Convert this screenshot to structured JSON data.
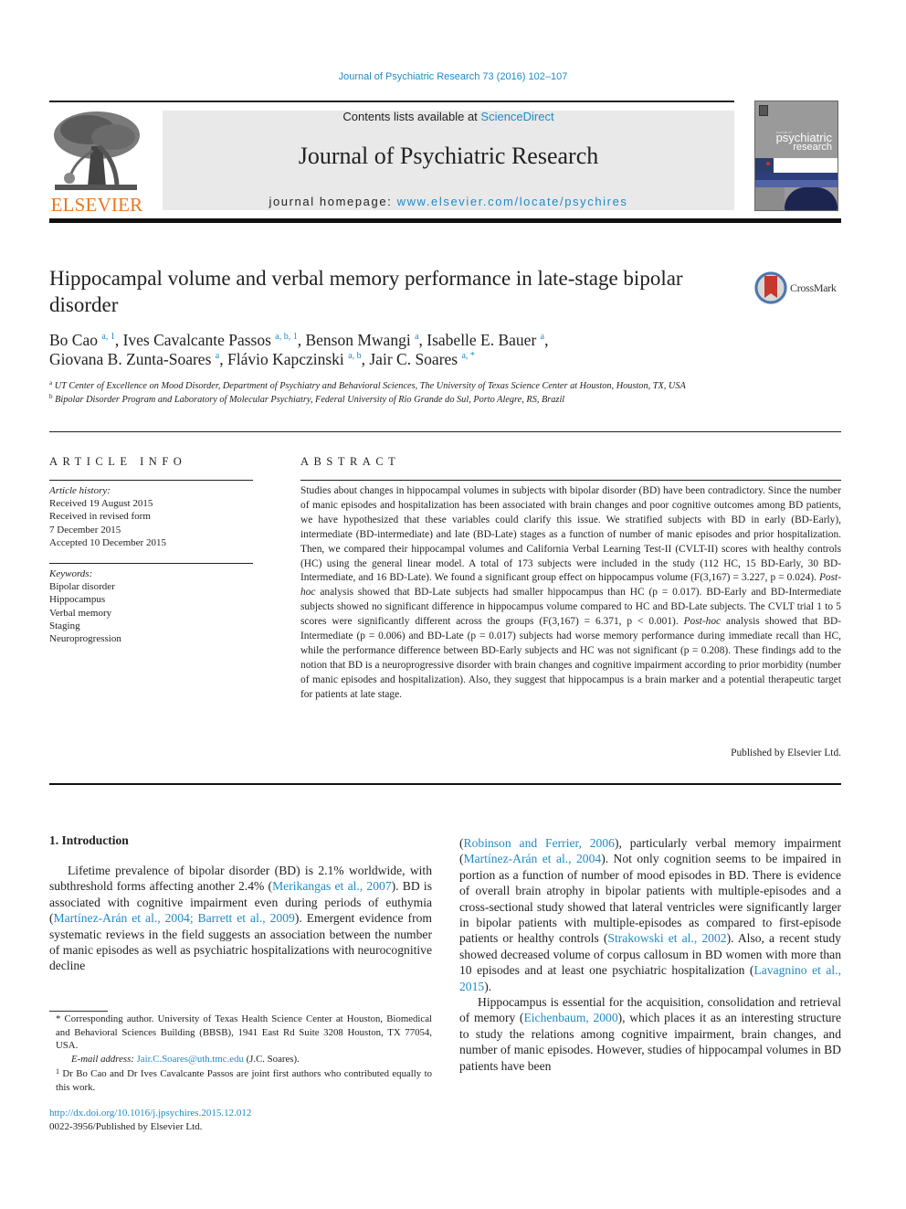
{
  "header": {
    "citation": "Journal of Psychiatric Research 73 (2016) 102–107",
    "publisher_logo_text": "ELSEVIER",
    "contents_prefix": "Contents lists available at ",
    "contents_link": "ScienceDirect",
    "journal_title": "Journal of Psychiatric Research",
    "homepage_prefix": "journal homepage: ",
    "homepage_link": "www.elsevier.com/locate/psychires",
    "cover": {
      "small_text": "Journal of",
      "title_line1": "psychiatric",
      "title_line2": "research"
    },
    "colors": {
      "link": "#1f8bc7",
      "elsevier_orange": "#e87722",
      "banner_bg": "#e9e9e9"
    }
  },
  "article": {
    "title": "Hippocampal volume and verbal memory performance in late-stage bipolar disorder",
    "crossmark_label": "CrossMark",
    "authors": [
      {
        "name": "Bo Cao",
        "sup": "a, 1",
        "sep": ", "
      },
      {
        "name": "Ives Cavalcante Passos",
        "sup": "a, b, 1",
        "sep": ", "
      },
      {
        "name": "Benson Mwangi",
        "sup": "a",
        "sep": ", "
      },
      {
        "name": "Isabelle E. Bauer",
        "sup": "a",
        "sep": ","
      },
      {
        "name": "Giovana B. Zunta-Soares",
        "sup": "a",
        "sep": ", "
      },
      {
        "name": "Flávio Kapczinski",
        "sup": "a, b",
        "sep": ", "
      },
      {
        "name": "Jair C. Soares",
        "sup": "a, *",
        "sep": ""
      }
    ],
    "affiliations": [
      {
        "mark": "a",
        "text": "UT Center of Excellence on Mood Disorder, Department of Psychiatry and Behavioral Sciences, The University of Texas Science Center at Houston, Houston, TX, USA"
      },
      {
        "mark": "b",
        "text": "Bipolar Disorder Program and Laboratory of Molecular Psychiatry, Federal University of Rio Grande do Sul, Porto Alegre, RS, Brazil"
      }
    ]
  },
  "article_info": {
    "heading": "ARTICLE INFO",
    "history_label": "Article history:",
    "history": [
      "Received 19 August 2015",
      "Received in revised form",
      "7 December 2015",
      "Accepted 10 December 2015"
    ],
    "keywords_label": "Keywords:",
    "keywords": [
      "Bipolar disorder",
      "Hippocampus",
      "Verbal memory",
      "Staging",
      "Neuroprogression"
    ]
  },
  "abstract": {
    "heading": "ABSTRACT",
    "p1": "Studies about changes in hippocampal volumes in subjects with bipolar disorder (BD) have been con­tradictory. Since the number of manic episodes and hospitalization has been associated with brain changes and poor cognitive outcomes among BD patients, we have hypothesized that these variables could clarify this issue. We stratified subjects with BD in early (BD-Early), intermediate (BD-interme­diate) and late (BD-Late) stages as a function of number of manic episodes and prior hospitalization. Then, we compared their hippocampal volumes and California Verbal Learning Test-II (CVLT-II) scores with healthy controls (HC) using the general linear model. A total of 173 subjects were included in the study (112 HC, 15 BD-Early, 30 BD-Intermediate, and 16 BD-Late). We found a significant group effect on hippocampus volume (F(3,167) = 3.227, p = 0.024). ",
    "posthoc1": "Post-hoc",
    "p2": " analysis showed that BD-Late subjects had smaller hippocampus than HC (p = 0.017). BD-Early and BD-Intermediate subjects showed no significant difference in hippocampus volume compared to HC and BD-Late subjects. The CVLT trial 1 to 5 scores were significantly different across the groups (F(3,167) = 6.371, p < 0.001). ",
    "posthoc2": "Post-hoc",
    "p3": " analysis showed that BD-Intermediate (p = 0.006) and BD-Late (p = 0.017) subjects had worse memory performance during immediate recall than HC, while the performance difference between BD-Early subjects and HC was not significant (p = 0.208). These findings add to the notion that BD is a neuroprogressive disorder with brain changes and cognitive impairment according to prior morbidity (number of manic episodes and hos­pitalization). Also, they suggest that hippocampus is a brain marker and a potential therapeutic target for patients at late stage.",
    "published_by": "Published by Elsevier Ltd."
  },
  "introduction": {
    "heading": "1.  Introduction",
    "left": {
      "t1": "Lifetime prevalence of bipolar disorder (BD) is 2.1% worldwide, with subthreshold forms affecting another 2.4% (",
      "r1": "Merikangas et al., 2007",
      "t2": "). BD is associated with cognitive impairment even during periods of euthymia (",
      "r2": "Martínez-Arán et al., 2004; Barrett et al., 2009",
      "t3": "). Emergent evidence from systematic reviews in the field suggests an association between the number of manic episodes as well as psychiatric hospitalizations with neurocognitive decline"
    },
    "right": {
      "t0": "(",
      "r1": "Robinson and Ferrier, 2006",
      "t1": "), particularly verbal memory impair­ment (",
      "r2": "Martínez-Arán et al., 2004",
      "t2": "). Not only cognition seems to be impaired in portion as a function of number of mood episodes in BD. There is evidence of overall brain atrophy in bipolar patients with multiple-episodes and a cross-sectional study showed that lateral ventricles were significantly larger in bipolar patients with multiple-episodes as compared to first-episode patients or healthy controls (",
      "r3": "Strakowski et al., 2002",
      "t3": "). Also, a recent study showed decreased volume of corpus callosum in BD women with more than 10 episodes and at least one psychiatric hospitalization (",
      "r4": "Lavagnino et al., 2015",
      "t4": ").",
      "p2_t1": "Hippocampus is essential for the acquisition, consolidation and retrieval of memory (",
      "p2_r1": "Eichenbaum, 2000",
      "p2_t2": "), which places it as an interesting structure to study the relations among cognitive impairment, brain changes, and number of manic episodes. How­ever, studies of hippocampal volumes in BD patients have been"
    }
  },
  "footnotes": {
    "corresponding_mark": "*",
    "corresponding": " Corresponding author. University of Texas Health Science Center at Houston, Biomedical and Behavioral Sciences Building (BBSB), 1941 East Rd Suite 3208 Houston, TX 77054, USA.",
    "email_label": "E-mail address:",
    "email": "Jair.C.Soares@uth.tmc.edu",
    "email_suffix": " (J.C. Soares).",
    "note1_mark": "1",
    "note1": " Dr Bo Cao and Dr Ives Cavalcante Passos are joint first authors who contributed equally to this work."
  },
  "doi": {
    "link": "http://dx.doi.org/10.1016/j.jpsychires.2015.12.012",
    "issn_line": "0022-3956/Published by Elsevier Ltd."
  }
}
